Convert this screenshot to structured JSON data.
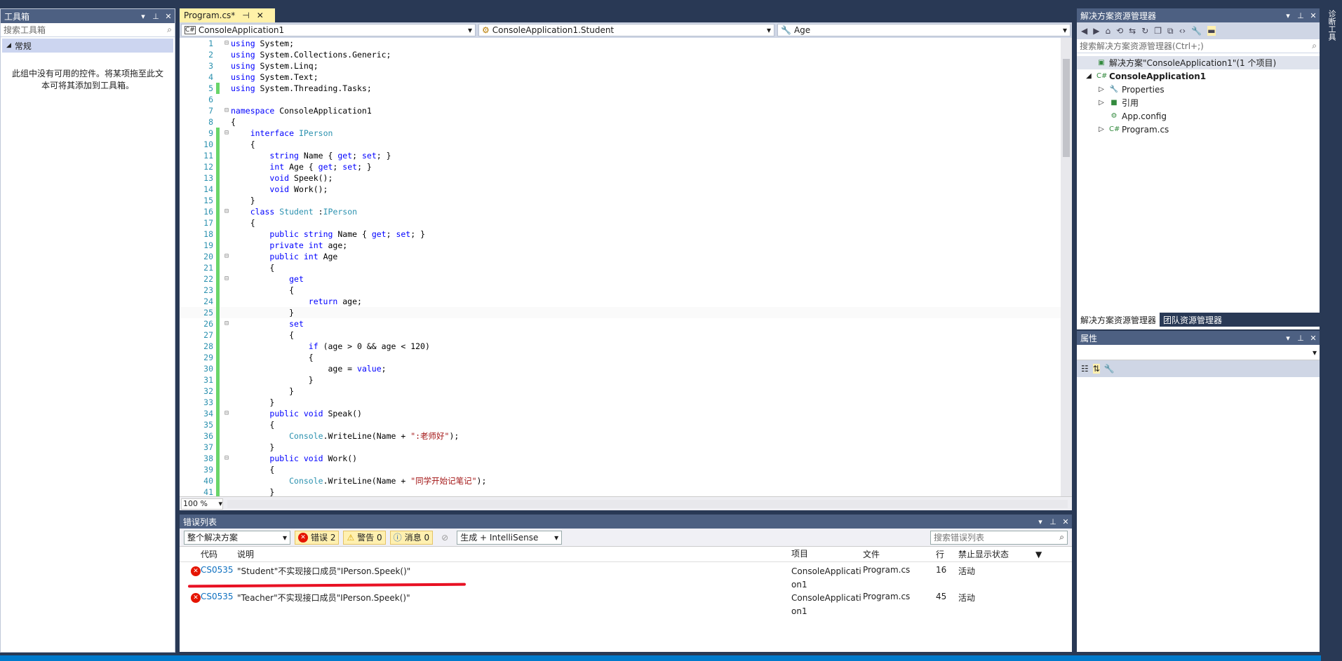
{
  "toolbox": {
    "title": "工具箱",
    "search_placeholder": "搜索工具箱",
    "group": "常规",
    "empty_msg": "此组中没有可用的控件。将某项拖至此文本可将其添加到工具箱。"
  },
  "editor": {
    "tab_label": "Program.cs*",
    "nav_project": "ConsoleApplication1",
    "nav_class": "ConsoleApplication1.Student",
    "nav_member": "Age",
    "zoom": "100 %",
    "lines": [
      {
        "n": "1",
        "t": [
          [
            "kw",
            "using"
          ],
          [
            "ct",
            " System;"
          ]
        ]
      },
      {
        "n": "2",
        "t": [
          [
            "kw",
            "using"
          ],
          [
            "ct",
            " System.Collections.Generic;"
          ]
        ]
      },
      {
        "n": "3",
        "t": [
          [
            "kw",
            "using"
          ],
          [
            "ct",
            " System.Linq;"
          ]
        ]
      },
      {
        "n": "4",
        "t": [
          [
            "kw",
            "using"
          ],
          [
            "ct",
            " System.Text;"
          ]
        ]
      },
      {
        "n": "5",
        "t": [
          [
            "kw",
            "using"
          ],
          [
            "ct",
            " System.Threading.Tasks;"
          ]
        ]
      },
      {
        "n": "6",
        "t": []
      },
      {
        "n": "7",
        "t": [
          [
            "kw",
            "namespace"
          ],
          [
            "ct",
            " ConsoleApplication1"
          ]
        ]
      },
      {
        "n": "8",
        "t": [
          [
            "ct",
            "{"
          ]
        ]
      },
      {
        "n": "9",
        "t": [
          [
            "ct",
            "    "
          ],
          [
            "kw",
            "interface"
          ],
          [
            "ct",
            " "
          ],
          [
            "ty",
            "IPerson"
          ]
        ]
      },
      {
        "n": "10",
        "t": [
          [
            "ct",
            "    {"
          ]
        ]
      },
      {
        "n": "11",
        "t": [
          [
            "ct",
            "        "
          ],
          [
            "kw",
            "string"
          ],
          [
            "ct",
            " Name { "
          ],
          [
            "kw",
            "get"
          ],
          [
            "ct",
            "; "
          ],
          [
            "kw",
            "set"
          ],
          [
            "ct",
            "; }"
          ]
        ]
      },
      {
        "n": "12",
        "t": [
          [
            "ct",
            "        "
          ],
          [
            "kw",
            "int"
          ],
          [
            "ct",
            " Age { "
          ],
          [
            "kw",
            "get"
          ],
          [
            "ct",
            "; "
          ],
          [
            "kw",
            "set"
          ],
          [
            "ct",
            "; }"
          ]
        ]
      },
      {
        "n": "13",
        "t": [
          [
            "ct",
            "        "
          ],
          [
            "kw",
            "void"
          ],
          [
            "ct",
            " Speek();"
          ]
        ]
      },
      {
        "n": "14",
        "t": [
          [
            "ct",
            "        "
          ],
          [
            "kw",
            "void"
          ],
          [
            "ct",
            " Work();"
          ]
        ]
      },
      {
        "n": "15",
        "t": [
          [
            "ct",
            "    }"
          ]
        ]
      },
      {
        "n": "16",
        "t": [
          [
            "ct",
            "    "
          ],
          [
            "kw",
            "class"
          ],
          [
            "ct",
            " "
          ],
          [
            "ty",
            "Student"
          ],
          [
            "ct",
            " :"
          ],
          [
            "ty",
            "IPerson"
          ]
        ]
      },
      {
        "n": "17",
        "t": [
          [
            "ct",
            "    {"
          ]
        ]
      },
      {
        "n": "18",
        "t": [
          [
            "ct",
            "        "
          ],
          [
            "kw",
            "public"
          ],
          [
            "ct",
            " "
          ],
          [
            "kw",
            "string"
          ],
          [
            "ct",
            " Name { "
          ],
          [
            "kw",
            "get"
          ],
          [
            "ct",
            "; "
          ],
          [
            "kw",
            "set"
          ],
          [
            "ct",
            "; }"
          ]
        ]
      },
      {
        "n": "19",
        "t": [
          [
            "ct",
            "        "
          ],
          [
            "kw",
            "private"
          ],
          [
            "ct",
            " "
          ],
          [
            "kw",
            "int"
          ],
          [
            "ct",
            " age;"
          ]
        ]
      },
      {
        "n": "20",
        "t": [
          [
            "ct",
            "        "
          ],
          [
            "kw",
            "public"
          ],
          [
            "ct",
            " "
          ],
          [
            "kw",
            "int"
          ],
          [
            "ct",
            " Age"
          ]
        ]
      },
      {
        "n": "21",
        "t": [
          [
            "ct",
            "        {"
          ]
        ]
      },
      {
        "n": "22",
        "t": [
          [
            "ct",
            "            "
          ],
          [
            "kw",
            "get"
          ]
        ]
      },
      {
        "n": "23",
        "t": [
          [
            "ct",
            "            {"
          ]
        ]
      },
      {
        "n": "24",
        "t": [
          [
            "ct",
            "                "
          ],
          [
            "kw",
            "return"
          ],
          [
            "ct",
            " age;"
          ]
        ]
      },
      {
        "n": "25",
        "t": [
          [
            "ct",
            "            }"
          ]
        ]
      },
      {
        "n": "26",
        "t": [
          [
            "ct",
            "            "
          ],
          [
            "kw",
            "set"
          ]
        ]
      },
      {
        "n": "27",
        "t": [
          [
            "ct",
            "            {"
          ]
        ]
      },
      {
        "n": "28",
        "t": [
          [
            "ct",
            "                "
          ],
          [
            "kw",
            "if"
          ],
          [
            "ct",
            " (age > 0 && age < 120)"
          ]
        ]
      },
      {
        "n": "29",
        "t": [
          [
            "ct",
            "                {"
          ]
        ]
      },
      {
        "n": "30",
        "t": [
          [
            "ct",
            "                    age = "
          ],
          [
            "kw",
            "value"
          ],
          [
            "ct",
            ";"
          ]
        ]
      },
      {
        "n": "31",
        "t": [
          [
            "ct",
            "                }"
          ]
        ]
      },
      {
        "n": "32",
        "t": [
          [
            "ct",
            "            }"
          ]
        ]
      },
      {
        "n": "33",
        "t": [
          [
            "ct",
            "        }"
          ]
        ]
      },
      {
        "n": "34",
        "t": [
          [
            "ct",
            "        "
          ],
          [
            "kw",
            "public"
          ],
          [
            "ct",
            " "
          ],
          [
            "kw",
            "void"
          ],
          [
            "ct",
            " Speak()"
          ]
        ]
      },
      {
        "n": "35",
        "t": [
          [
            "ct",
            "        {"
          ]
        ]
      },
      {
        "n": "36",
        "t": [
          [
            "ct",
            "            "
          ],
          [
            "ty",
            "Console"
          ],
          [
            "ct",
            ".WriteLine(Name + "
          ],
          [
            "st",
            "\":老师好\""
          ],
          [
            "ct",
            ");"
          ]
        ]
      },
      {
        "n": "37",
        "t": [
          [
            "ct",
            "        }"
          ]
        ]
      },
      {
        "n": "38",
        "t": [
          [
            "ct",
            "        "
          ],
          [
            "kw",
            "public"
          ],
          [
            "ct",
            " "
          ],
          [
            "kw",
            "void"
          ],
          [
            "ct",
            " Work()"
          ]
        ]
      },
      {
        "n": "39",
        "t": [
          [
            "ct",
            "        {"
          ]
        ]
      },
      {
        "n": "40",
        "t": [
          [
            "ct",
            "            "
          ],
          [
            "ty",
            "Console"
          ],
          [
            "ct",
            ".WriteLine(Name + "
          ],
          [
            "st",
            "\"同学开始记笔记\""
          ],
          [
            "ct",
            ");"
          ]
        ]
      },
      {
        "n": "41",
        "t": [
          [
            "ct",
            "        }"
          ]
        ]
      }
    ]
  },
  "solution_explorer": {
    "title": "解决方案资源管理器",
    "search_placeholder": "搜索解决方案资源管理器(Ctrl+;)",
    "items": [
      {
        "label": "解决方案\"ConsoleApplication1\"(1 个项目)",
        "indent": 10,
        "icon": "▣",
        "exp": "",
        "bold": false,
        "sel": true
      },
      {
        "label": "ConsoleApplication1",
        "indent": 10,
        "icon": "C#",
        "exp": "◢",
        "bold": true,
        "sel": false
      },
      {
        "label": "Properties",
        "indent": 28,
        "icon": "🔧",
        "exp": "▷",
        "bold": false,
        "sel": false
      },
      {
        "label": "引用",
        "indent": 28,
        "icon": "■",
        "exp": "▷",
        "bold": false,
        "sel": false
      },
      {
        "label": "App.config",
        "indent": 28,
        "icon": "⚙",
        "exp": "",
        "bold": false,
        "sel": false
      },
      {
        "label": "Program.cs",
        "indent": 28,
        "icon": "C#",
        "exp": "▷",
        "bold": false,
        "sel": false
      }
    ],
    "tab_active": "解决方案资源管理器",
    "tab_other": "团队资源管理器"
  },
  "properties": {
    "title": "属性"
  },
  "right_strip": {
    "label": "诊断工具"
  },
  "error_list": {
    "title": "错误列表",
    "scope": "整个解决方案",
    "errors_btn": "错误 2",
    "warnings_btn": "警告 0",
    "messages_btn": "消息 0",
    "build_filter": "生成 + IntelliSense",
    "search_placeholder": "搜索错误列表",
    "headers": {
      "code": "代码",
      "desc": "说明",
      "project": "项目",
      "file": "文件",
      "line": "行",
      "suppress": "禁止显示状态"
    },
    "rows": [
      {
        "code": "CS0535",
        "desc": "\"Student\"不实现接口成员\"IPerson.Speek()\"",
        "project": "ConsoleApplication1",
        "file": "Program.cs",
        "line": "16",
        "state": "活动"
      },
      {
        "code": "CS0535",
        "desc": "\"Teacher\"不实现接口成员\"IPerson.Speek()\"",
        "project": "ConsoleApplication1",
        "file": "Program.cs",
        "line": "45",
        "state": "活动"
      }
    ]
  },
  "colors": {
    "accent": "#007acc",
    "panel_title": "#4d6082",
    "error_red": "#e51400",
    "annotation": "#e81123"
  }
}
